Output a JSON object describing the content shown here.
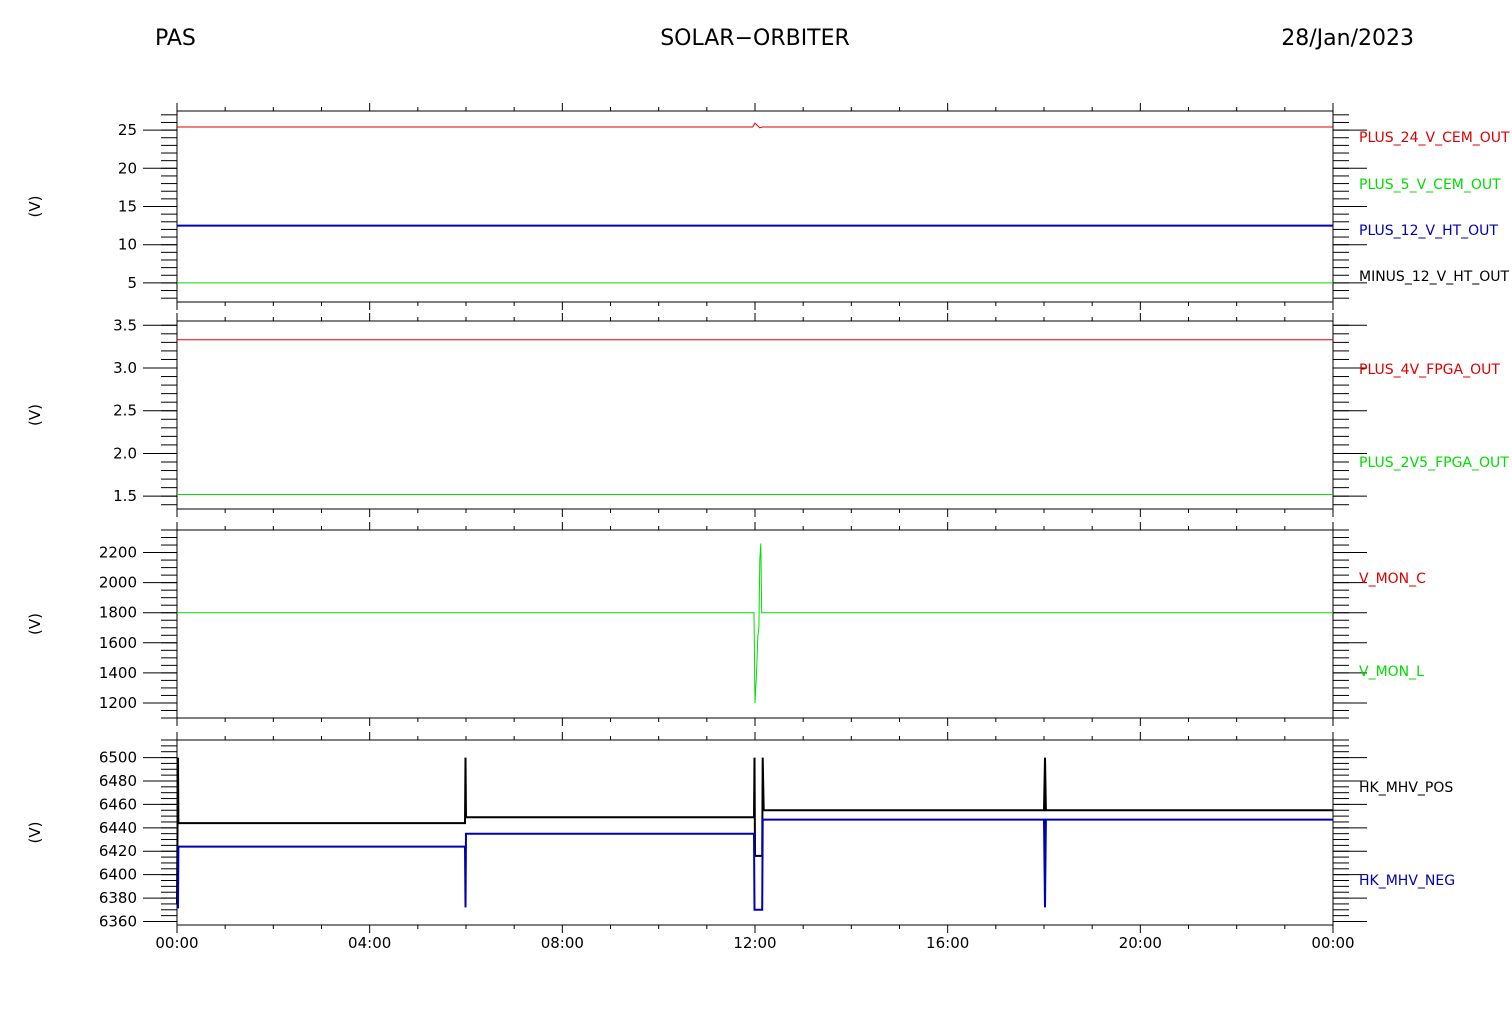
{
  "header": {
    "left": "PAS",
    "center": "SOLAR−ORBITER",
    "right": "28/Jan/2023"
  },
  "colors": {
    "red": "#e00000",
    "green": "#00dd00",
    "blue": "#0000b4",
    "black": "#000000"
  },
  "chart_data": [
    {
      "type": "line",
      "ylabel": "(V)",
      "ylim": [
        2.5,
        27.5
      ],
      "yticks": [
        5,
        10,
        15,
        20,
        25
      ],
      "y_minor_step": 1,
      "xlim": [
        0,
        24
      ],
      "x_tick_labels": [
        "00:00",
        "04:00",
        "08:00",
        "12:00",
        "16:00",
        "20:00",
        "00:00"
      ],
      "series": [
        {
          "name": "PLUS_24_V_CEM_OUT",
          "color": "#e00000",
          "width": 1,
          "x": [
            0,
            11.95,
            12.0,
            12.05,
            12.1,
            12.15,
            24
          ],
          "y": [
            25.4,
            25.4,
            25.9,
            25.6,
            25.3,
            25.4,
            25.4
          ]
        },
        {
          "name": "PLUS_5_V_CEM_OUT",
          "color": "#00dd00",
          "width": 1,
          "x": [],
          "y": []
        },
        {
          "name": "PLUS_12_V_HT_OUT",
          "color": "#0000b4",
          "width": 2,
          "x": [
            0,
            24
          ],
          "y": [
            12.5,
            12.5
          ]
        },
        {
          "name": "MINUS_12_V_HT_OUT",
          "color": "#000000",
          "width": 1,
          "x": [],
          "y": []
        },
        {
          "name": "",
          "color": "#00dd00",
          "width": 1,
          "x": [
            0,
            24
          ],
          "y": [
            5.0,
            5.0
          ]
        }
      ]
    },
    {
      "type": "line",
      "ylabel": "(V)",
      "ylim": [
        1.35,
        3.55
      ],
      "yticks": [
        1.5,
        2.0,
        2.5,
        3.0,
        3.5
      ],
      "y_minor_step": 0.1,
      "xlim": [
        0,
        24
      ],
      "x_tick_labels": [
        "00:00",
        "04:00",
        "08:00",
        "12:00",
        "16:00",
        "20:00",
        "00:00"
      ],
      "series": [
        {
          "name": "PLUS_4V_FPGA_OUT",
          "color": "#e00000",
          "width": 1,
          "x": [
            0,
            24
          ],
          "y": [
            3.33,
            3.33
          ]
        },
        {
          "name": "PLUS_2V5_FPGA_OUT",
          "color": "#00dd00",
          "width": 1,
          "x": [
            0,
            24
          ],
          "y": [
            1.52,
            1.52
          ]
        }
      ]
    },
    {
      "type": "line",
      "ylabel": "(V)",
      "ylim": [
        1100,
        2350
      ],
      "yticks": [
        1200,
        1400,
        1600,
        1800,
        2000,
        2200
      ],
      "y_minor_step": 50,
      "xlim": [
        0,
        24
      ],
      "x_tick_labels": [
        "00:00",
        "04:00",
        "08:00",
        "12:00",
        "16:00",
        "20:00",
        "00:00"
      ],
      "series": [
        {
          "name": "V_MON_C",
          "color": "#e00000",
          "width": 1,
          "x": [],
          "y": []
        },
        {
          "name": "V_MON_L",
          "color": "#00dd00",
          "width": 1,
          "x": [
            0,
            11.98,
            12.0,
            12.03,
            12.06,
            12.08,
            12.1,
            12.12,
            12.14,
            12.16,
            24
          ],
          "y": [
            1800,
            1800,
            1200,
            1380,
            1650,
            1700,
            2150,
            2260,
            1800,
            1800,
            1800
          ]
        }
      ]
    },
    {
      "type": "line",
      "ylabel": "(V)",
      "ylim": [
        6357,
        6515
      ],
      "yticks": [
        6360,
        6380,
        6400,
        6420,
        6440,
        6460,
        6480,
        6500
      ],
      "y_minor_step": 5,
      "xlim": [
        0,
        24
      ],
      "x_tick_labels": [
        "00:00",
        "04:00",
        "08:00",
        "12:00",
        "16:00",
        "20:00",
        "00:00"
      ],
      "series": [
        {
          "name": "HK_MHV_POS",
          "color": "#000000",
          "width": 2,
          "x": [
            0,
            0.02,
            0.03,
            0.05,
            5.98,
            5.99,
            6.0,
            6.02,
            11.98,
            11.99,
            12.0,
            12.02,
            12.15,
            12.16,
            12.18,
            12.2,
            18.0,
            18.02,
            18.04,
            24
          ],
          "y": [
            6375,
            6500,
            6444,
            6444,
            6444,
            6500,
            6449,
            6449,
            6449,
            6500,
            6416,
            6416,
            6416,
            6500,
            6455,
            6455,
            6455,
            6500,
            6455,
            6455
          ]
        },
        {
          "name": "HK_MHV_NEG",
          "color": "#0000b4",
          "width": 2,
          "x": [
            0,
            0.02,
            0.03,
            0.05,
            5.98,
            5.99,
            6.0,
            6.02,
            11.98,
            11.99,
            12.0,
            12.02,
            12.15,
            12.16,
            12.18,
            12.2,
            18.0,
            18.02,
            18.04,
            24
          ],
          "y": [
            6372,
            6372,
            6424,
            6424,
            6424,
            6372,
            6435,
            6435,
            6435,
            6370,
            6370,
            6370,
            6370,
            6447,
            6447,
            6447,
            6447,
            6372,
            6447,
            6447
          ]
        }
      ]
    }
  ]
}
